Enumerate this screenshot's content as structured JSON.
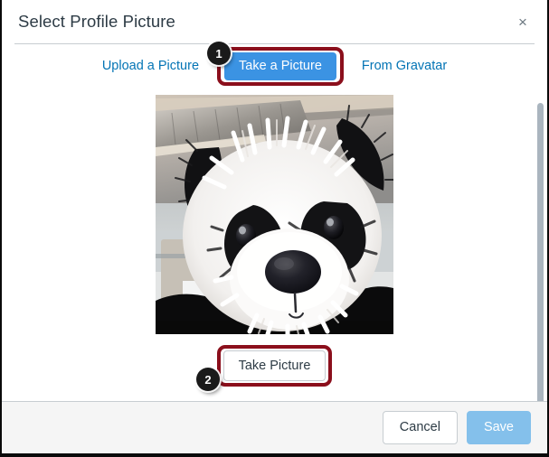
{
  "dialog": {
    "title": "Select Profile Picture",
    "close_label": "×",
    "close_icon": "close-icon"
  },
  "tabs": [
    {
      "label": "Upload a Picture",
      "active": false
    },
    {
      "label": "Take a Picture",
      "active": true
    },
    {
      "label": "From Gravatar",
      "active": false
    }
  ],
  "annotations": [
    {
      "number": "1",
      "target": "take-a-picture-tab"
    },
    {
      "number": "2",
      "target": "take-picture-button"
    }
  ],
  "preview": {
    "alt": "Webcam preview showing a panda mascot costume head",
    "icon": "webcam-preview"
  },
  "actions": {
    "take_picture": "Take Picture",
    "cancel": "Cancel",
    "save": "Save"
  },
  "colors": {
    "tab_active_bg": "#3b93e3",
    "tab_link": "#0374b5",
    "annotation_outline": "#8b0f1c",
    "badge_bg": "#1a1a1a",
    "title_text": "#2d3b45",
    "save_disabled_bg": "#84c0eb",
    "footer_bg": "#f5f5f5",
    "border": "#c7cdd1",
    "scrollbar_thumb": "#aab5bf"
  }
}
